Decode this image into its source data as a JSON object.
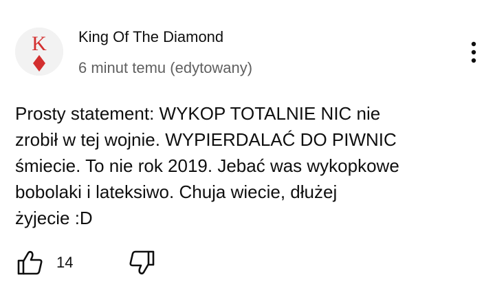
{
  "comment": {
    "author": "King Of The Diamond",
    "timestamp": "6 minut temu (edytowany)",
    "avatar": {
      "letter": "K",
      "suit": "diamond",
      "color": "#d32f2f"
    },
    "text_lines": [
      "Prosty statement: WYKOP TOTALNIE NIC nie",
      "zrobił w tej wojnie. WYPIERDALAĆ DO PIWNIC",
      "śmiecie. To nie rok 2019. Jebać was wykopkowe",
      "bobolaki i lateksiwo. Chuja wiecie, dłużej",
      "żyjecie :D"
    ],
    "like_count": "14"
  },
  "icons": {
    "like": "thumbs-up-icon",
    "dislike": "thumbs-down-icon",
    "more": "more-vertical-icon"
  }
}
